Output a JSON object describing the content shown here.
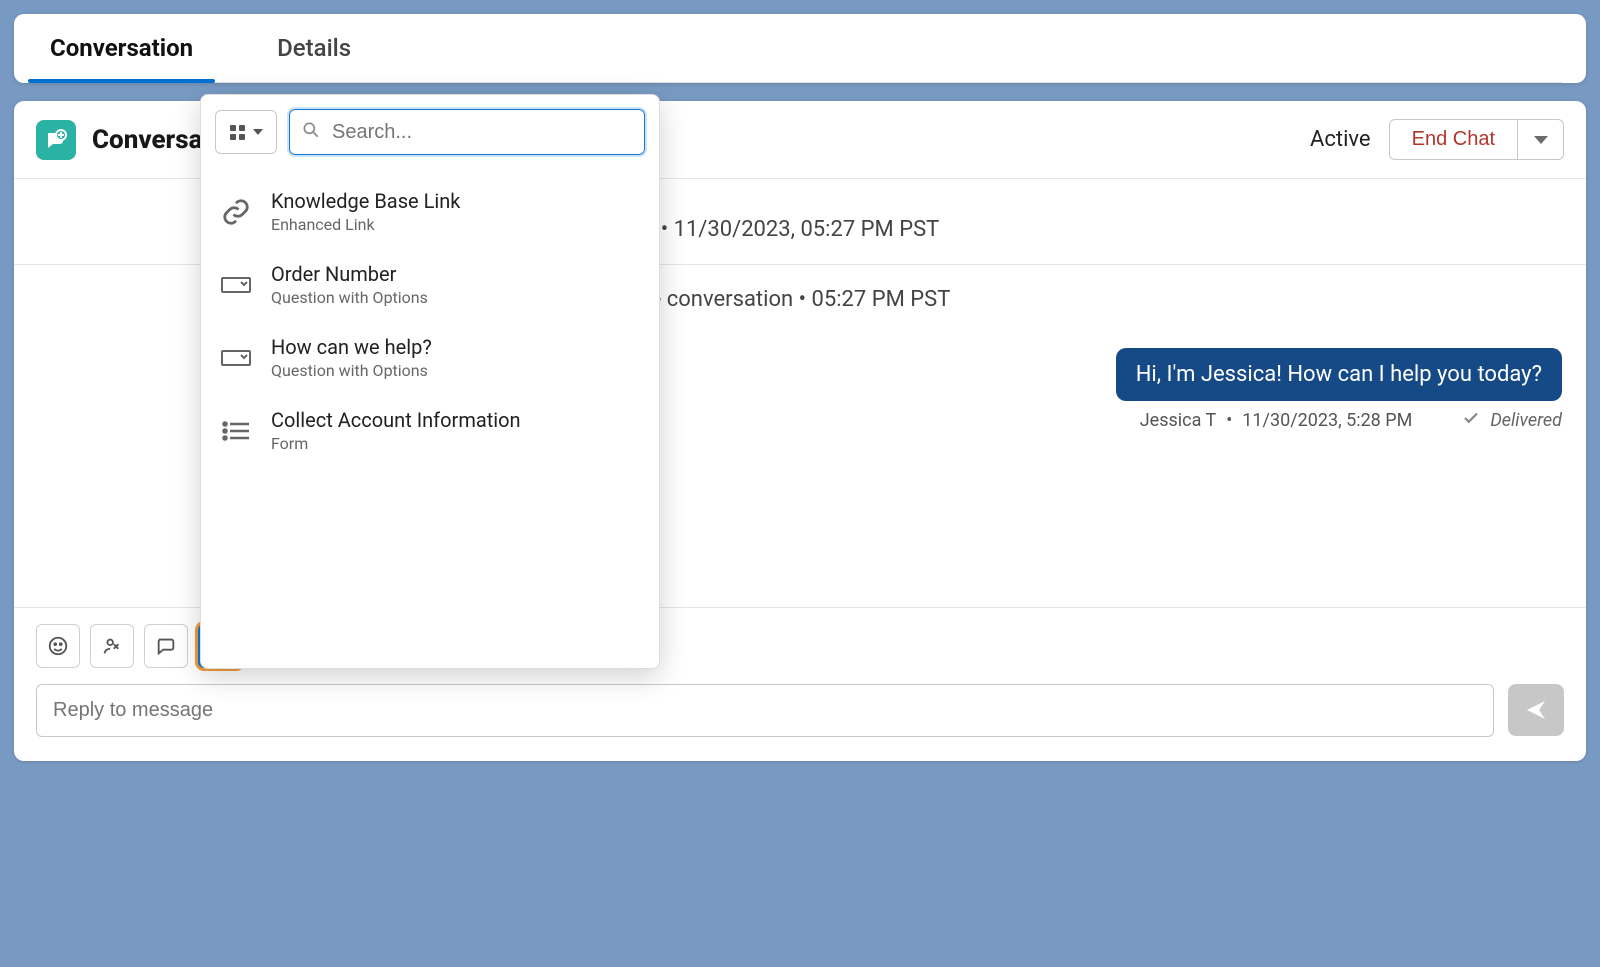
{
  "tabs": {
    "conversation": "Conversation",
    "details": "Details"
  },
  "header": {
    "title": "Conversation",
    "status": "Active",
    "end_chat_label": "End Chat"
  },
  "thread": {
    "system_line_1": "• 11/30/2023, 05:27 PM PST",
    "system_line_2_suffix": "e conversation • 05:27 PM PST",
    "message_text": "Hi, I'm Jessica! How can I help you today?",
    "message_author": "Jessica T",
    "message_time": "11/30/2023, 5:28 PM",
    "delivered_label": "Delivered"
  },
  "composer": {
    "reply_placeholder": "Reply to message"
  },
  "popover": {
    "search_placeholder": "Search...",
    "items": [
      {
        "title": "Knowledge Base Link",
        "subtitle": "Enhanced Link"
      },
      {
        "title": "Order Number",
        "subtitle": "Question with Options"
      },
      {
        "title": "How can we help?",
        "subtitle": "Question with Options"
      },
      {
        "title": "Collect Account Information",
        "subtitle": "Form"
      }
    ]
  }
}
